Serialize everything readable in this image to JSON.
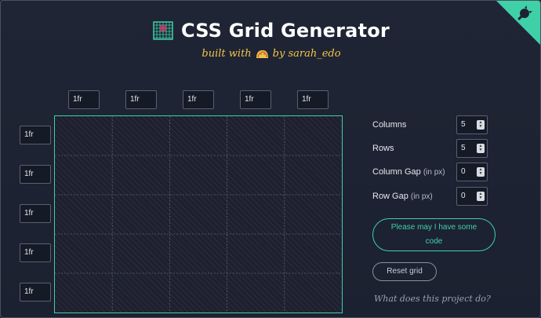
{
  "header": {
    "title": "CSS Grid Generator",
    "subtitle_prefix": "built with",
    "subtitle_suffix": "by sarah_edo",
    "icon": "grid-icon",
    "taco_icon": "taco-icon"
  },
  "grid": {
    "columns_values": [
      "1fr",
      "1fr",
      "1fr",
      "1fr",
      "1fr"
    ],
    "rows_values": [
      "1fr",
      "1fr",
      "1fr",
      "1fr",
      "1fr"
    ],
    "accent_color": "#3fd0a8"
  },
  "controls": {
    "columns_label": "Columns",
    "columns_value": "5",
    "rows_label": "Rows",
    "rows_value": "5",
    "column_gap_label": "Column Gap",
    "column_gap_unit": "(in px)",
    "column_gap_value": "0",
    "row_gap_label": "Row Gap",
    "row_gap_unit": "(in px)",
    "row_gap_value": "0"
  },
  "buttons": {
    "code_label": "Please may I have some code",
    "reset_label": "Reset grid"
  },
  "footer": {
    "about_link": "What does this project do?"
  },
  "corner": {
    "icon": "github-octocat-icon",
    "color": "#3fd0a8"
  }
}
